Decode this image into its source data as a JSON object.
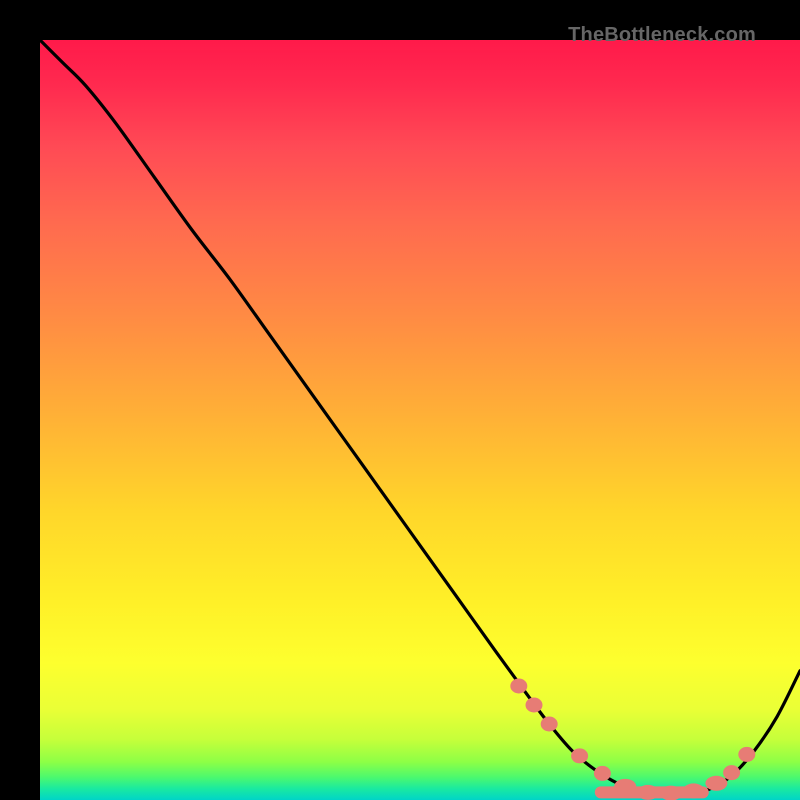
{
  "watermark": "TheBottleneck.com",
  "colors": {
    "background": "#000000",
    "curve": "#000000",
    "bead_fill": "#e77c75",
    "gradient_top": "#ff1a4a",
    "gradient_mid": "#ffd62a",
    "gradient_bottom": "#00d4c8"
  },
  "chart_data": {
    "type": "line",
    "title": "",
    "xlabel": "",
    "ylabel": "",
    "xlim": [
      0,
      100
    ],
    "ylim": [
      0,
      100
    ],
    "series": [
      {
        "name": "bottleneck-curve",
        "x": [
          0,
          3,
          6,
          10,
          15,
          20,
          25,
          30,
          35,
          40,
          45,
          50,
          55,
          60,
          64,
          67,
          70,
          73,
          76,
          79,
          82,
          85,
          88,
          91,
          94,
          97,
          100
        ],
        "values": [
          100,
          97,
          94,
          89,
          82,
          75,
          68.5,
          61.5,
          54.5,
          47.5,
          40.5,
          33.5,
          26.5,
          19.5,
          14,
          10,
          6.5,
          4,
          2.2,
          1.2,
          0.8,
          0.8,
          1.4,
          3.2,
          6.5,
          11,
          17
        ]
      }
    ],
    "bead_points": {
      "x": [
        63,
        65,
        67,
        71,
        74,
        77,
        80,
        83,
        86,
        89,
        91,
        93
      ],
      "values": [
        15,
        12.5,
        10,
        5.8,
        3.5,
        1.8,
        1.0,
        0.9,
        1.2,
        2.2,
        3.6,
        6.0
      ]
    }
  }
}
